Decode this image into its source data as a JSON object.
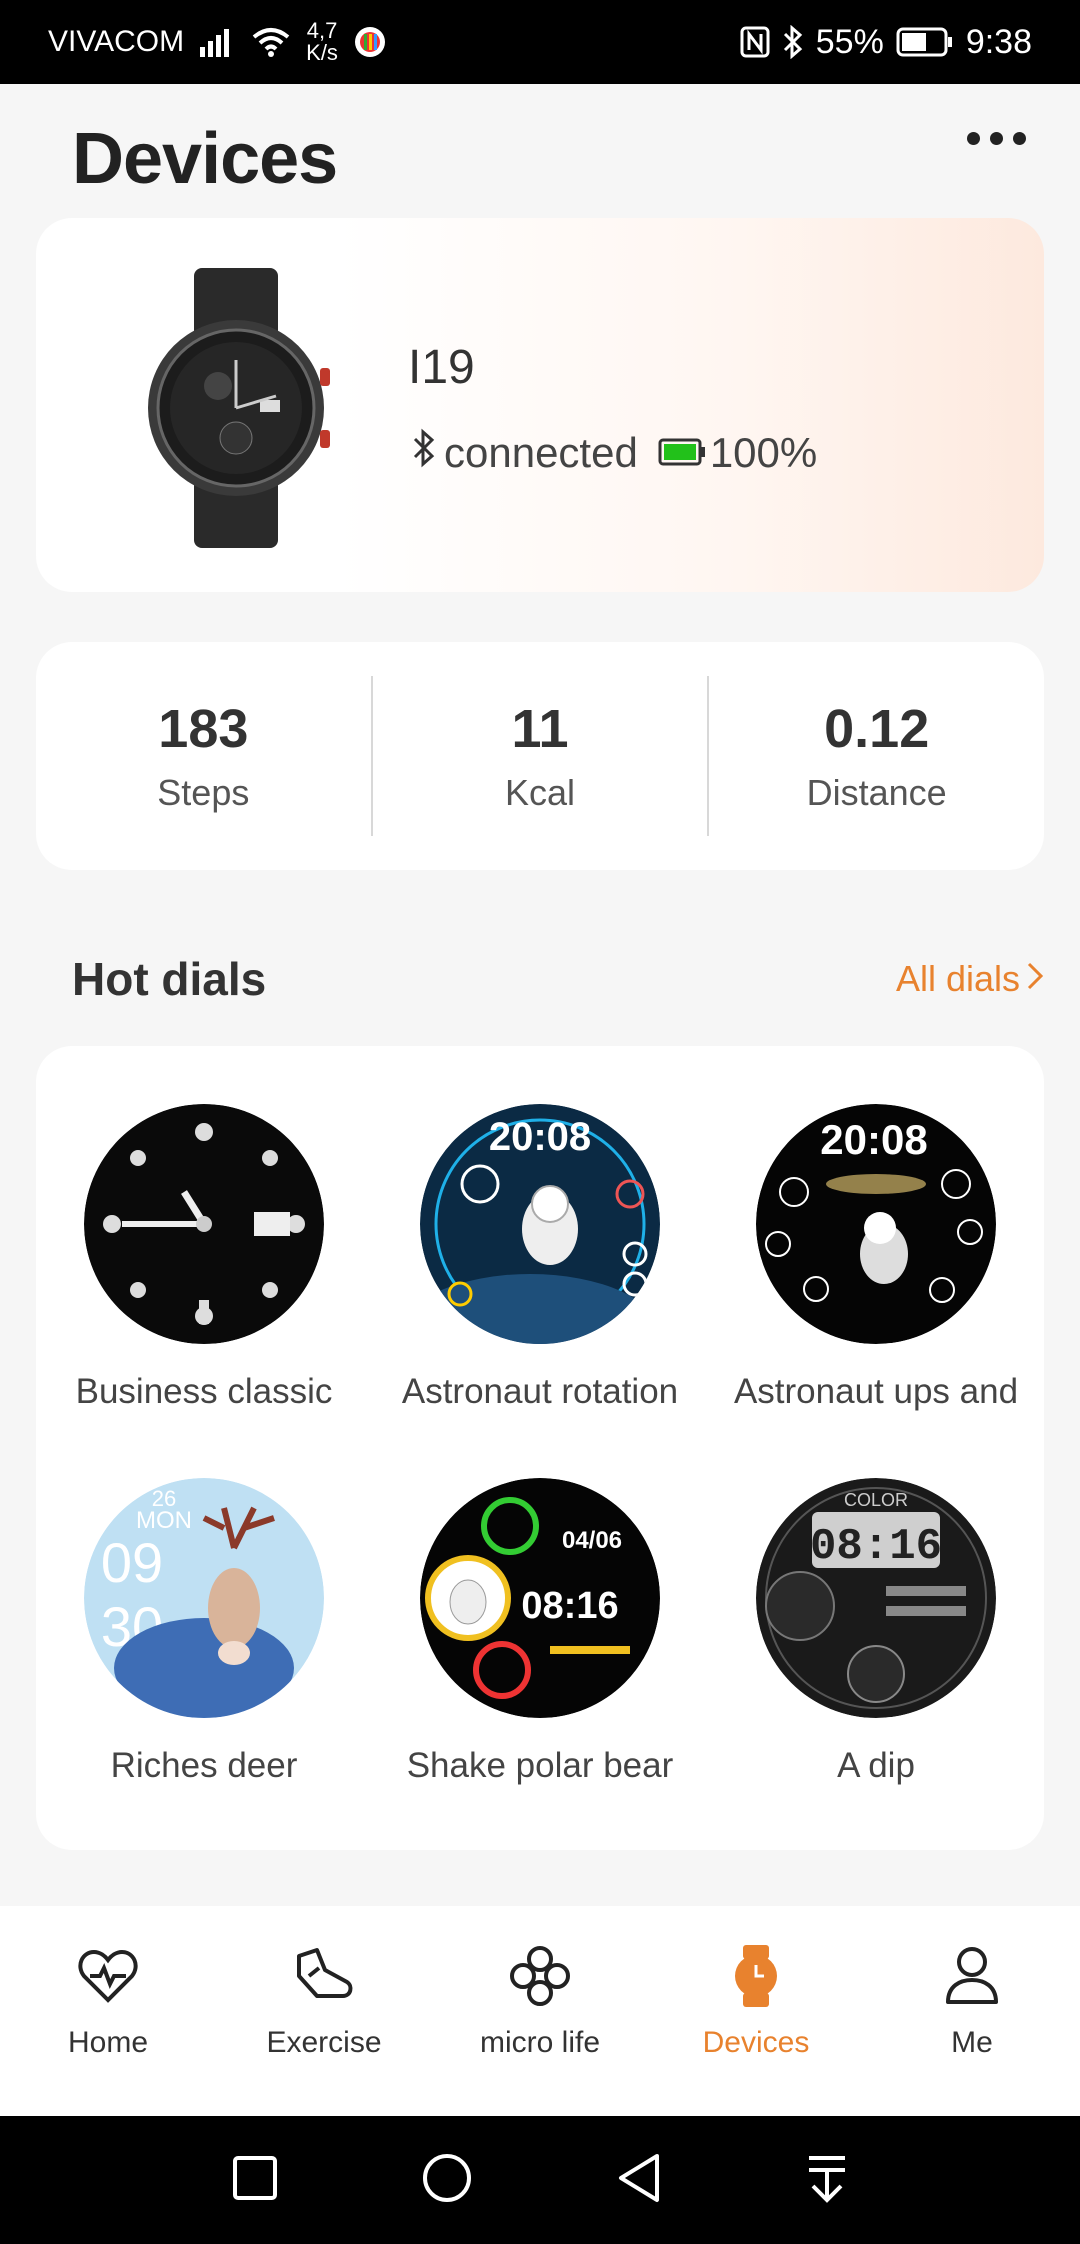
{
  "status_bar": {
    "carrier": "VIVACOM",
    "speed_value": "4,7",
    "speed_unit": "K/s",
    "battery": "55%",
    "time": "9:38"
  },
  "header": {
    "title": "Devices"
  },
  "device": {
    "name": "I19",
    "connection": "connected",
    "battery": "100%"
  },
  "stats": [
    {
      "value": "183",
      "label": "Steps"
    },
    {
      "value": "11",
      "label": "Kcal"
    },
    {
      "value": "0.12",
      "label": "Distance"
    }
  ],
  "hot_dials": {
    "title": "Hot dials",
    "all_link": "All dials",
    "dials": [
      {
        "name": "Business classic"
      },
      {
        "name": "Astronaut rotation",
        "time": "20:08"
      },
      {
        "name": "Astronaut ups and",
        "time": "20:08"
      },
      {
        "name": "Riches deer",
        "date": "26",
        "month": "MON",
        "hour": "09",
        "minute": "30"
      },
      {
        "name": "Shake polar bear",
        "time": "08:16",
        "date": "04/06"
      },
      {
        "name": "A dip",
        "time": "08:16",
        "brand": "COLOR"
      }
    ]
  },
  "bottom_nav": {
    "items": [
      {
        "label": "Home",
        "icon": "heart-pulse-icon"
      },
      {
        "label": "Exercise",
        "icon": "shoe-icon"
      },
      {
        "label": "micro life",
        "icon": "clover-icon"
      },
      {
        "label": "Devices",
        "icon": "watch-icon"
      },
      {
        "label": "Me",
        "icon": "person-icon"
      }
    ],
    "active": "Devices"
  },
  "colors": {
    "accent": "#e8822e",
    "battery_green": "#22c11a"
  }
}
